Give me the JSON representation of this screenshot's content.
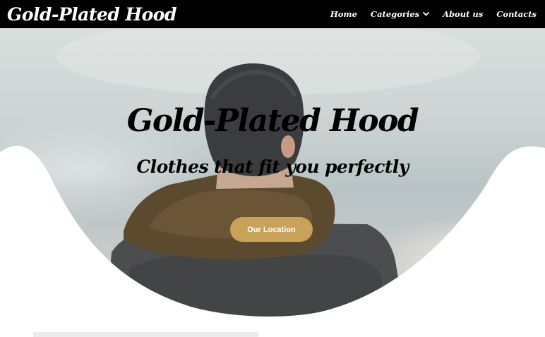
{
  "brand": {
    "name": "Gold-Plated Hood"
  },
  "nav": {
    "home": "Home",
    "categories": "Categories",
    "about": "About us",
    "contacts": "Contacts"
  },
  "hero": {
    "title": "Gold-Plated Hood",
    "subtitle": "Clothes that fit you perfectly",
    "button_label": "Our Location"
  },
  "icons": {
    "categories_dropdown": "chevron-down-icon"
  },
  "colors": {
    "navbar": "#000000",
    "accent": "#c9a25a",
    "wave": "#ffffff"
  }
}
